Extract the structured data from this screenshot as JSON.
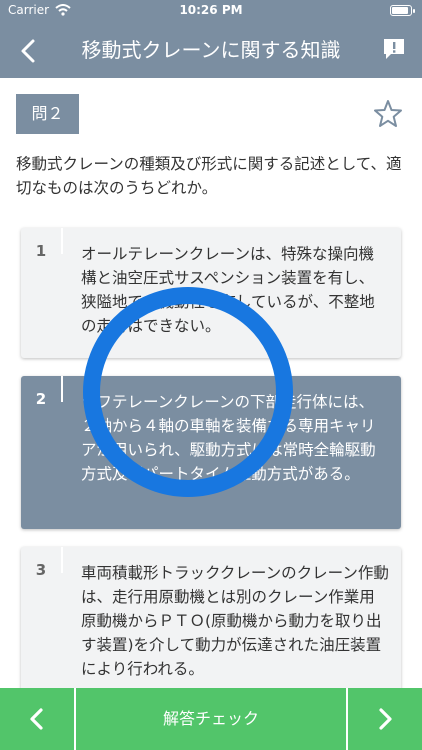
{
  "status": {
    "carrier": "Carrier",
    "time": "10:26 PM"
  },
  "header": {
    "title": "移動式クレーンに関する知識"
  },
  "question": {
    "label": "問２",
    "text": "移動式クレーンの種類及び形式に関する記述として、適切なものは次のうちどれか。"
  },
  "options": [
    {
      "num": "1",
      "text": "オールテレーンクレーンは、特殊な操向機構と油空圧式サスペンション装置を有し、狭隘地での機動性を有しているが、不整地の走行はできない。",
      "selected": false
    },
    {
      "num": "2",
      "text": "ラフテレーンクレーンの下部走行体には、２軸から４軸の車軸を装備する専用キャリアが用いられ、駆動方式には常時全輪駆動方式及びパートタイム駆動方式がある。",
      "selected": true
    },
    {
      "num": "3",
      "text": "車両積載形トラッククレーンのクレーン作動は、走行用原動機とは別のクレーン作業用原動機からＰＴＯ(原動機から動力を取り出す装置)を介して動力が伝達された油圧装置により行われる。",
      "selected": false
    }
  ],
  "footer": {
    "check_label": "解答チェック"
  },
  "colors": {
    "nav": "#7b8ea1",
    "footer": "#52c56a",
    "ring": "#1877e0"
  },
  "icons": {
    "back": "chevron-left-icon",
    "report": "report-icon",
    "favorite": "star-icon",
    "prev": "chevron-left-icon",
    "next": "chevron-right-icon"
  }
}
